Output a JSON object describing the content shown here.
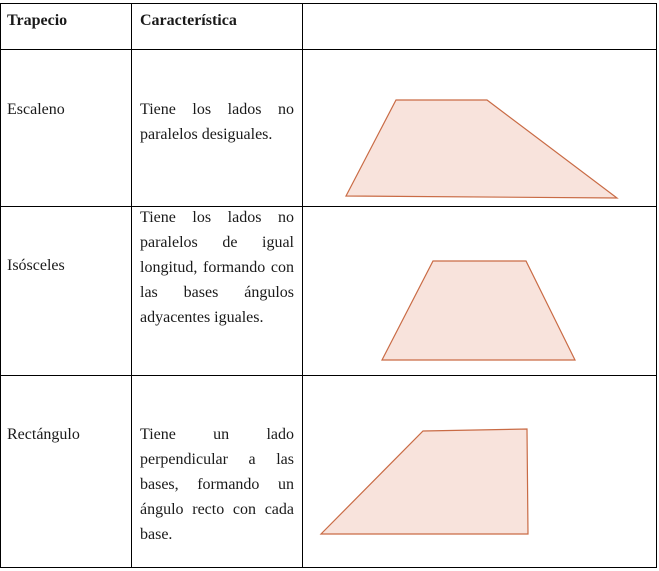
{
  "table": {
    "headers": [
      "Trapecio",
      "Característica",
      ""
    ],
    "rows": [
      {
        "name": "Escaleno",
        "description": "Tiene los lados no paralelos desiguales.",
        "shape": "scalene-trapezoid"
      },
      {
        "name": "Isósceles",
        "description": "Tiene los lados no paralelos de igual longitud, formando con las bases ángulos adyacentes iguales.",
        "shape": "isosceles-trapezoid"
      },
      {
        "name": "Rectángulo",
        "description": "Tiene un lado perpendicular a las bases, formando un ángulo recto con cada base.",
        "shape": "right-trapezoid"
      }
    ]
  },
  "colors": {
    "shape_fill": "#f8e3dc",
    "shape_stroke": "#c96b45",
    "border": "#000000"
  }
}
